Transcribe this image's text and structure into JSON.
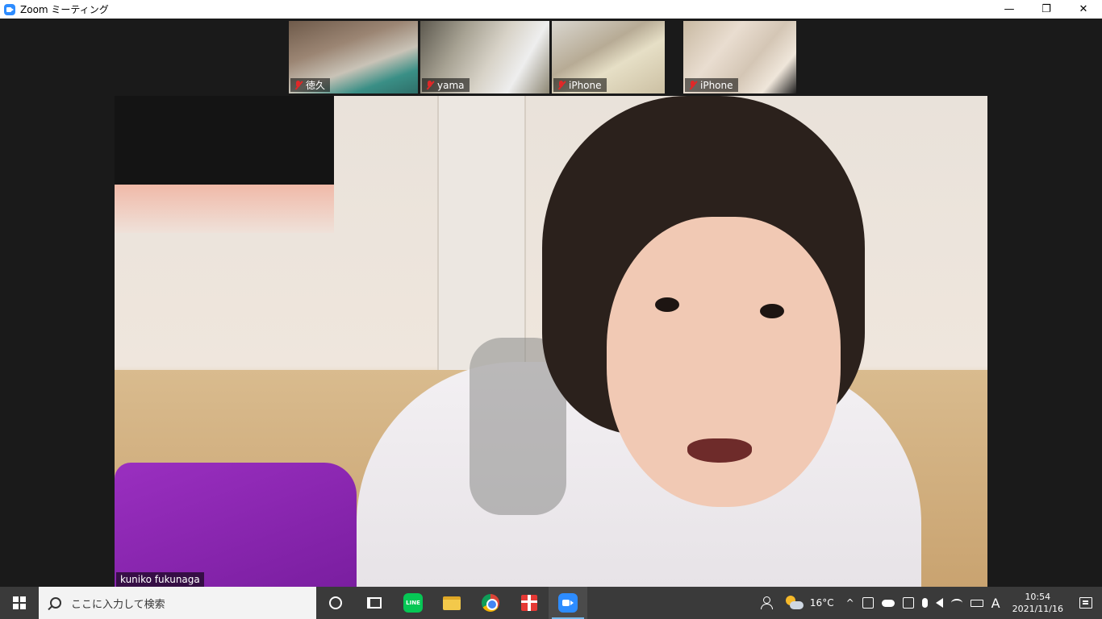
{
  "window": {
    "title": "Zoom ミーティング",
    "minimize": "—",
    "restore": "❐",
    "close": "✕"
  },
  "participants": [
    {
      "name": "徳久",
      "muted": true
    },
    {
      "name": "yama",
      "muted": true
    },
    {
      "name": "iPhone",
      "muted": true
    },
    {
      "name": "iPhone",
      "muted": true
    }
  ],
  "active_speaker": {
    "name": "kuniko fukunaga"
  },
  "taskbar": {
    "search_placeholder": "ここに入力して検索",
    "apps": [
      "cortana",
      "task-view",
      "line",
      "file-explorer",
      "chrome",
      "gift",
      "zoom"
    ],
    "line_label": "LINE",
    "weather_temp": "16°C",
    "ime": "A",
    "time": "10:54",
    "date": "2021/11/16",
    "accent_color": "#76b9ed"
  }
}
